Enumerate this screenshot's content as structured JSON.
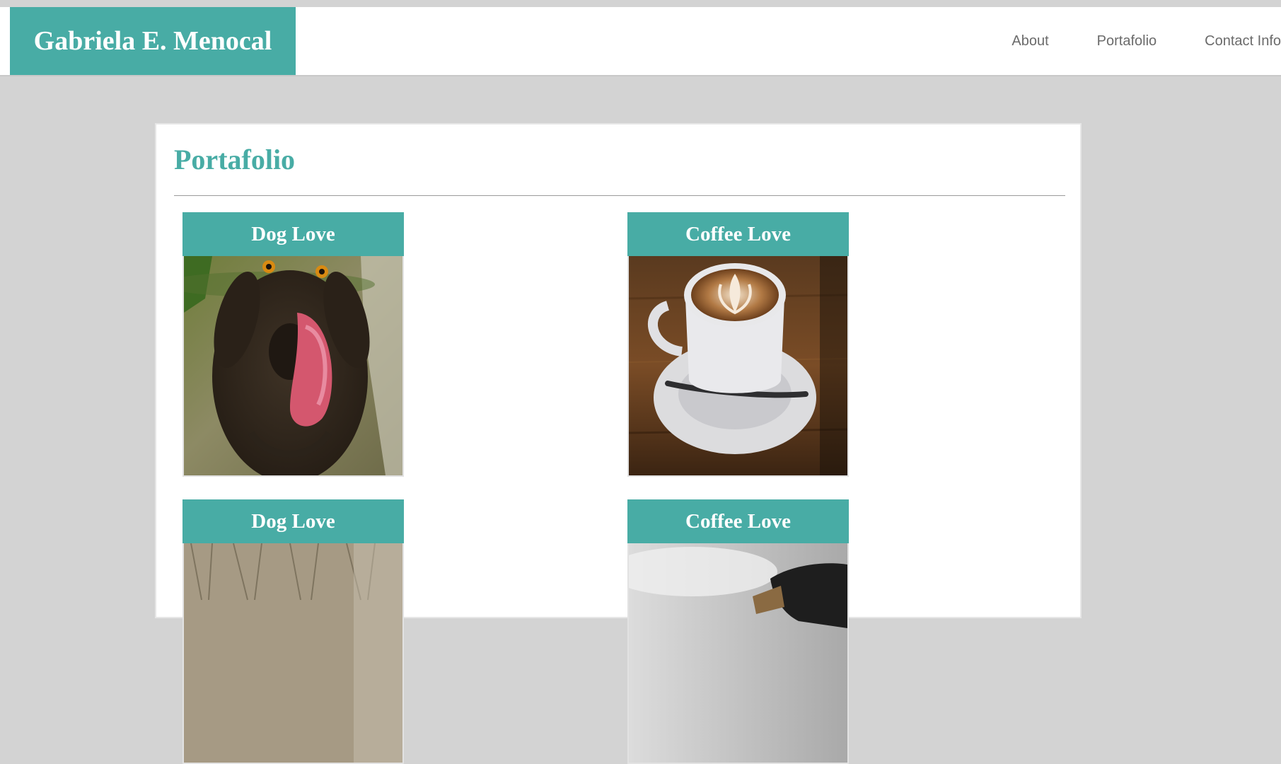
{
  "header": {
    "brand": "Gabriela E. Menocal",
    "nav": [
      {
        "label": "About"
      },
      {
        "label": "Portafolio"
      },
      {
        "label": "Contact Info"
      }
    ]
  },
  "main": {
    "title": "Portafolio",
    "tiles": [
      {
        "title": "Dog Love",
        "image": "dog-licking-photo"
      },
      {
        "title": "Coffee Love",
        "image": "latte-cup-photo"
      },
      {
        "title": "Dog Love",
        "image": "dog-in-grass-photo"
      },
      {
        "title": "Coffee Love",
        "image": "pour-over-coffee-photo"
      }
    ]
  },
  "colors": {
    "accent": "#48aca5",
    "background": "#d3d3d3",
    "nav_text": "#6b6b6b"
  }
}
